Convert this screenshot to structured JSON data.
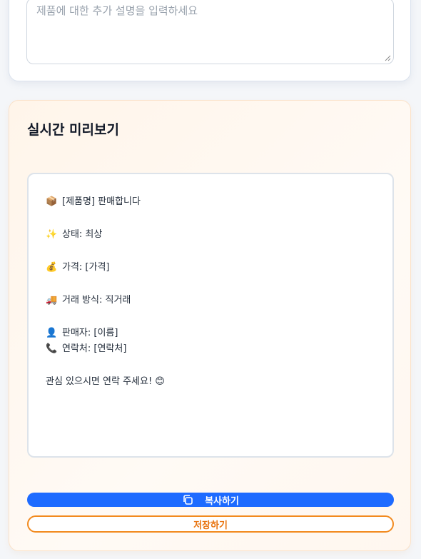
{
  "description_field": {
    "placeholder": "제품에 대한 추가 설명을 입력하세요"
  },
  "preview": {
    "title": "실시간 미리보기",
    "lines": [
      {
        "icon": "📦",
        "icon_name": "package-icon",
        "text": "[제품명] 판매합니다"
      },
      {
        "icon": "✨",
        "icon_name": "sparkles-icon",
        "text": "상태: 최상"
      },
      {
        "icon": "💰",
        "icon_name": "money-bag-icon",
        "text": "가격: [가격]"
      },
      {
        "icon": "🚚",
        "icon_name": "delivery-truck-icon",
        "text": "거래 방식: 직거래"
      },
      {
        "icon": "👤",
        "icon_name": "person-icon",
        "text": "판매자: [이름]"
      },
      {
        "icon": "📞",
        "icon_name": "phone-icon",
        "text": "연락처: [연락처]"
      },
      {
        "icon": "",
        "icon_name": "",
        "text": "관심 있으시면 연락 주세요! 😊"
      }
    ]
  },
  "actions": {
    "copy_label": "복사하기",
    "save_label": "저장하기"
  },
  "colors": {
    "primary": "#1e6bff",
    "accent_orange": "#f28a1e"
  }
}
